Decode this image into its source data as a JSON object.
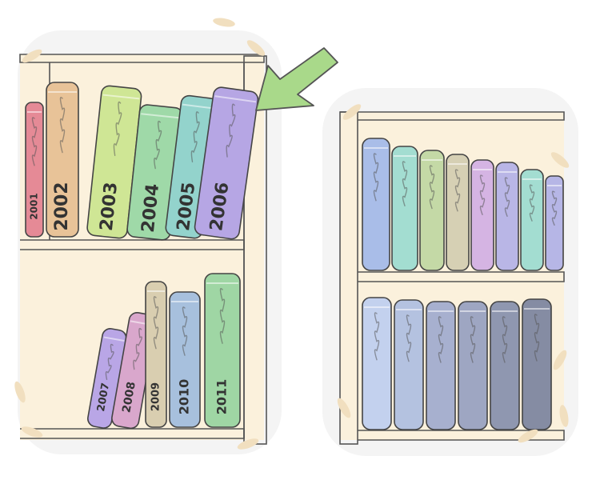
{
  "illustration": {
    "left_shelf": {
      "top_row_books": [
        {
          "year": "2001",
          "color": "#e58a96"
        },
        {
          "year": "2002",
          "color": "#e8c398"
        },
        {
          "year": "2003",
          "color": "#cfe695"
        },
        {
          "year": "2004",
          "color": "#9fd9a8"
        },
        {
          "year": "2005",
          "color": "#93d3cc"
        },
        {
          "year": "2006",
          "color": "#b6a6e4"
        }
      ],
      "bottom_row_books": [
        {
          "year": "2007",
          "color": "#b9a6e6"
        },
        {
          "year": "2008",
          "color": "#d9a7cc"
        },
        {
          "year": "2009",
          "color": "#d9ceb0"
        },
        {
          "year": "2010",
          "color": "#a7c0dd"
        },
        {
          "year": "2011",
          "color": "#9fd6a4"
        }
      ]
    },
    "right_shelf": {
      "top_row_colors": [
        "#a9bde8",
        "#a3ddd1",
        "#c4d9a6",
        "#d6d0b4",
        "#d5b4e3",
        "#b9b6e6",
        "#a3ddd1",
        "#b6b6e6"
      ],
      "bottom_row_colors": [
        "#c3d1ee",
        "#b4c2e0",
        "#a7b0cf",
        "#9ea6c2",
        "#8f97b0",
        "#858ca3"
      ]
    },
    "colors": {
      "shelf_wood": "#f7e8c9",
      "shelf_inner": "#fbf1dc",
      "arrow": "#a9d98a",
      "frame_shadow": "#eeeeee",
      "corner_accent": "#f1dfbf"
    },
    "icons": [
      "bookshelf-icon",
      "arrow-icon"
    ]
  }
}
